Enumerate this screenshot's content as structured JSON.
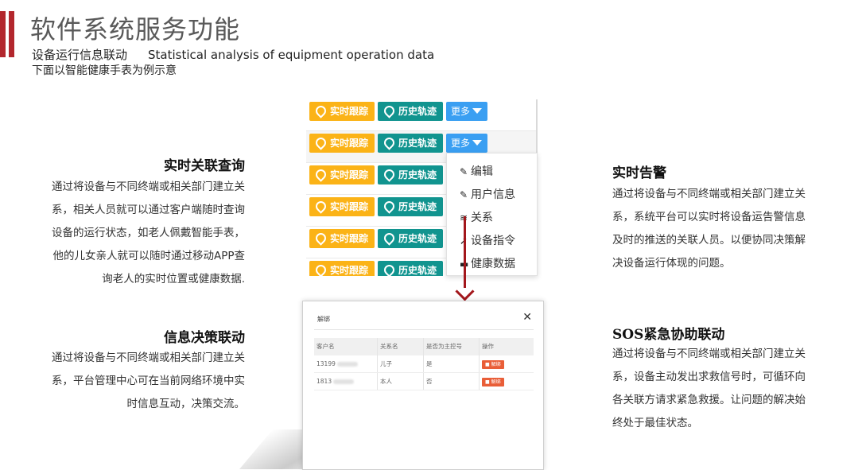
{
  "header": {
    "title": "软件系统服务功能",
    "subtitle_cn": "设备运行信息联动",
    "subtitle_en": "Statistical analysis of equipment operation data",
    "subtitle_2": "下面以智能健康手表为例示意",
    "accent_color": "#b3272d"
  },
  "sections": {
    "realtime_query": {
      "title": "实时关联查询",
      "lines": [
        "通过将设备与不同终端或相关部门建立关",
        "系，相关人员就可以通过客户端随时查询",
        "设备的运行状态，如老人佩戴智能手表，",
        "他的儿女亲人就可以随时通过移动APP查",
        "询老人的实时位置或健康数据."
      ]
    },
    "decision": {
      "title": "信息决策联动",
      "lines": [
        "通过将设备与不同终端或相关部门建立关",
        "系，平台管理中心可在当前网络环境中实",
        "时信息互动，决策交流。"
      ]
    },
    "alarm": {
      "title": "实时告警",
      "lines": [
        "通过将设备与不同终端或相关部门建立关",
        "系，系统平台可以实时将设备运告警信息",
        "及时的推送的关联人员。以便协同决策解",
        "决设备运行体现的问题。"
      ]
    },
    "sos": {
      "title": "SOS紧急协助联动",
      "lines": [
        "通过将设备与不同终端或相关部门建立关",
        "系，设备主动发出求救信号时，可循环向",
        "各关联方请求紧急救援。让问题的解决始",
        "终处于最佳状态。"
      ]
    }
  },
  "ops_table": {
    "btn_track": "实时跟踪",
    "btn_history": "历史轨迹",
    "btn_more": "更多",
    "track_color": "#fbb317",
    "history_color": "#11948f",
    "more_color": "#3a9ff2",
    "rows": [
      1,
      2,
      3,
      4,
      5,
      6
    ]
  },
  "dropdown": {
    "items": [
      {
        "icon": "pencil-icon",
        "label": "编辑"
      },
      {
        "icon": "pencil-icon",
        "label": "用户信息"
      },
      {
        "icon": "layers-icon",
        "label": "关系"
      },
      {
        "icon": "send-icon",
        "label": "设备指令"
      },
      {
        "icon": "card-icon",
        "label": "健康数据"
      }
    ]
  },
  "modal": {
    "title": "解绑",
    "close": "✕",
    "columns": [
      "客户名",
      "关系名",
      "是否为主控号",
      "操作"
    ],
    "rows": [
      {
        "name": "13199",
        "relation": "儿子",
        "is_master": "是",
        "action": "解绑"
      },
      {
        "name": "1813",
        "relation": "本人",
        "is_master": "否",
        "action": "解绑"
      }
    ]
  }
}
